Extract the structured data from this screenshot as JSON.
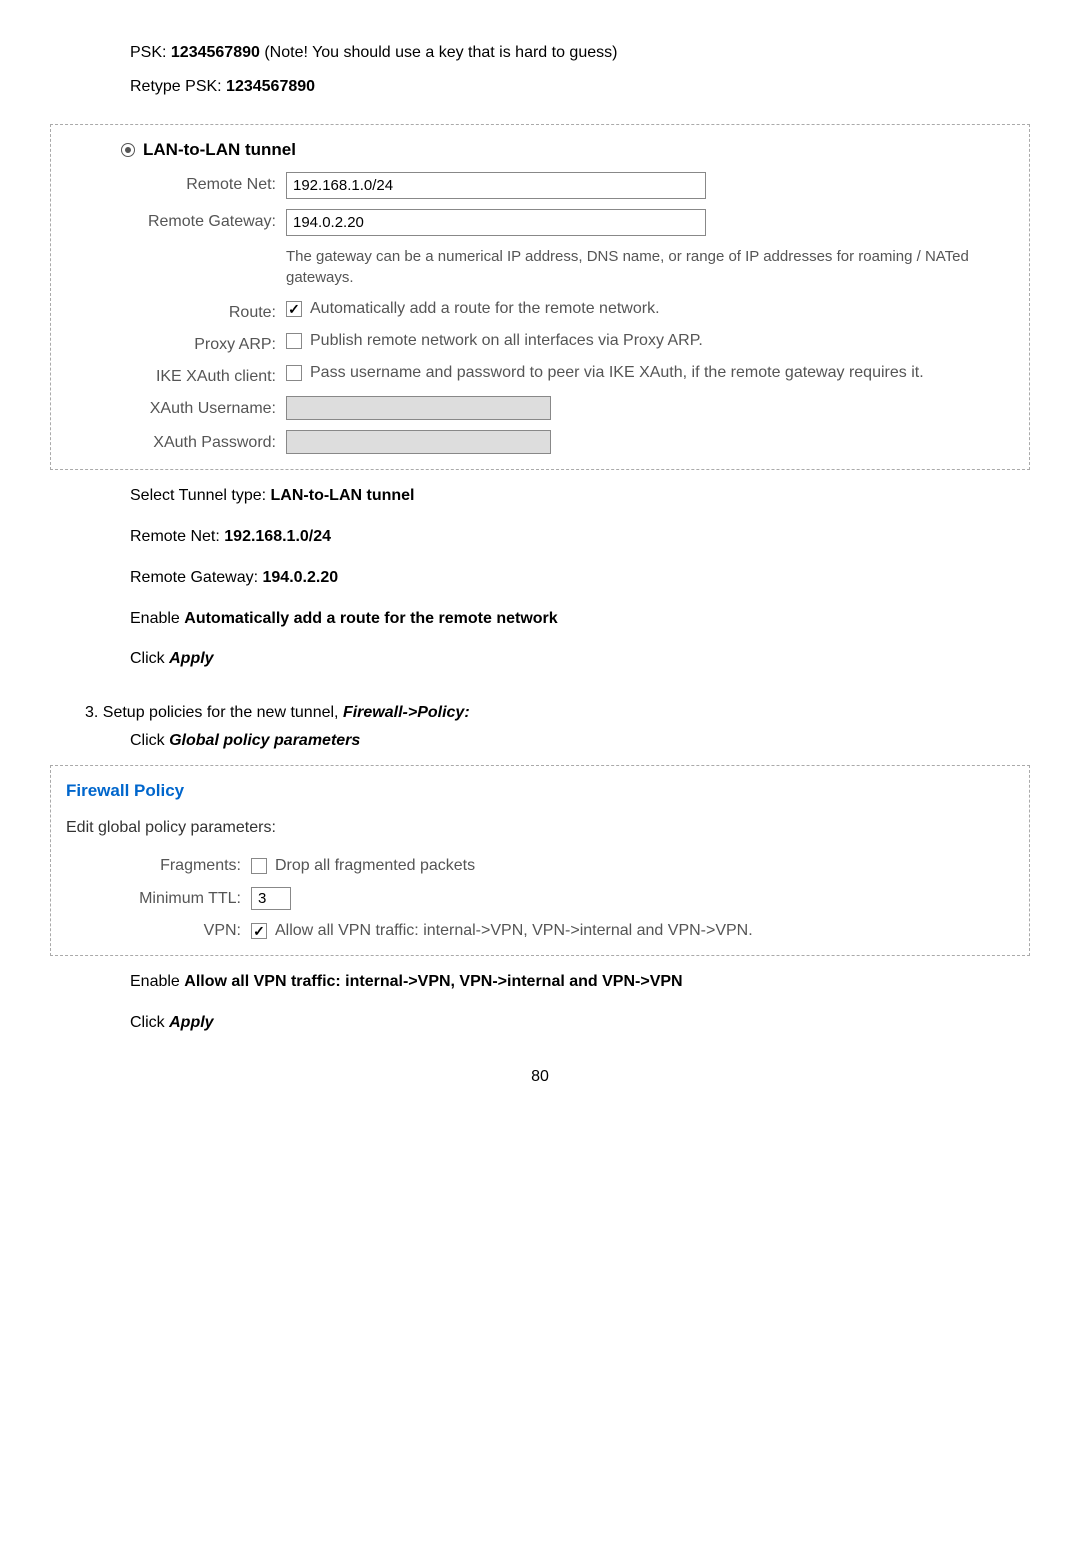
{
  "intro": {
    "psk_label": "PSK: ",
    "psk_value": "1234567890",
    "psk_note": " (Note! You should use a key that is hard to guess)",
    "retype_label": "Retype PSK: ",
    "retype_value": "1234567890"
  },
  "lan_panel": {
    "title": "LAN-to-LAN tunnel",
    "remote_net_label": "Remote Net:",
    "remote_net_value": "192.168.1.0/24",
    "remote_gateway_label": "Remote Gateway:",
    "remote_gateway_value": "194.0.2.20",
    "gateway_help": "The gateway can be a numerical IP address, DNS name, or range of IP addresses for roaming / NATed gateways.",
    "route_label": "Route:",
    "route_text": "Automatically add a route for the remote network.",
    "proxy_arp_label": "Proxy ARP:",
    "proxy_arp_text": "Publish remote network on all interfaces via Proxy ARP.",
    "ike_label": "IKE XAuth client:",
    "ike_text": "Pass username and password to peer via IKE XAuth, if the remote gateway requires it.",
    "xauth_user_label": "XAuth Username:",
    "xauth_pass_label": "XAuth Password:"
  },
  "post_panel": {
    "select_tunnel_pre": "Select Tunnel type: ",
    "select_tunnel_bold": "LAN-to-LAN tunnel",
    "remote_net_pre": "Remote Net: ",
    "remote_net_bold": "192.168.1.0/24",
    "remote_gw_pre": "Remote Gateway: ",
    "remote_gw_bold": "194.0.2.20",
    "enable_pre": "Enable ",
    "enable_bold": "Automatically add a route for the remote network",
    "click_pre": "Click ",
    "click_bold": "Apply"
  },
  "step3": {
    "text_pre": "3. Setup policies for the new tunnel, ",
    "text_bold": "Firewall->Policy:",
    "click_pre": "Click ",
    "click_bold": "Global policy parameters"
  },
  "policy_panel": {
    "title": "Firewall Policy",
    "subtitle": "Edit global policy parameters:",
    "fragments_label": "Fragments:",
    "fragments_text": "Drop all fragmented packets",
    "min_ttl_label": "Minimum TTL:",
    "min_ttl_value": "3",
    "vpn_label": "VPN:",
    "vpn_text": "Allow all VPN traffic: internal->VPN, VPN->internal and VPN->VPN."
  },
  "post_policy": {
    "enable_pre": "Enable ",
    "enable_bold": "Allow all VPN traffic: internal->VPN, VPN->internal and VPN->VPN",
    "click_pre": "Click ",
    "click_bold": "Apply"
  },
  "page_number": "80"
}
